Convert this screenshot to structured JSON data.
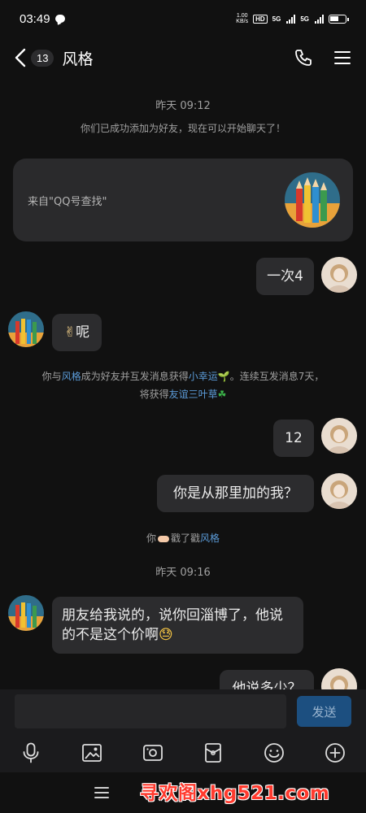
{
  "status_bar": {
    "time": "03:49",
    "net_speed_value": "1.00",
    "net_speed_unit": "KB/s",
    "hd_label": "HD",
    "signal_1_label": "5G",
    "signal_2_label": "5G"
  },
  "nav": {
    "unread_count": "13",
    "title": "风格"
  },
  "chat": {
    "time_1": "昨天 09:12",
    "added_notice": "你们已成功添加为好友，现在可以开始聊天了！",
    "source_card_text": "来自\"QQ号查找\"",
    "msg_out_1": "一次4",
    "msg_in_1_emoji": "✌",
    "msg_in_1_text": "呢",
    "streak_part1": "你与",
    "streak_link1": "风格",
    "streak_part2": "成为好友并互发消息获得",
    "streak_link2": "小幸运",
    "streak_emoji1": "🌱",
    "streak_part3": "。连续互发消息7天，",
    "streak_part4": "将获得",
    "streak_link3": "友谊三叶草",
    "streak_emoji2": "☘",
    "msg_out_2": "12",
    "msg_out_3": "你是从那里加的我？",
    "poke_you": "你",
    "poke_action": "戳了戳",
    "poke_target": "风格",
    "time_2": "昨天 09:16",
    "msg_in_2": "朋友给我说的，说你回淄博了，他说的不是这个价啊",
    "msg_in_2_emoji": "😓",
    "msg_out_4_partial": "他说多少？"
  },
  "input": {
    "placeholder": "",
    "send_label": "发送"
  },
  "watermark": "寻欢阁xhg521.com",
  "icons": {
    "back": "chevron-left-icon",
    "call": "phone-icon",
    "menu": "hamburger-menu-icon",
    "voice": "microphone-icon",
    "image": "image-icon",
    "camera": "camera-icon",
    "red_packet": "red-packet-icon",
    "emoji": "smiley-icon",
    "more": "plus-circle-icon"
  },
  "colors": {
    "background": "#111111",
    "bubble": "#2c2c2e",
    "link": "#5b9bd8",
    "send_button": "#1c4f80",
    "watermark": "#ff3a2e"
  }
}
